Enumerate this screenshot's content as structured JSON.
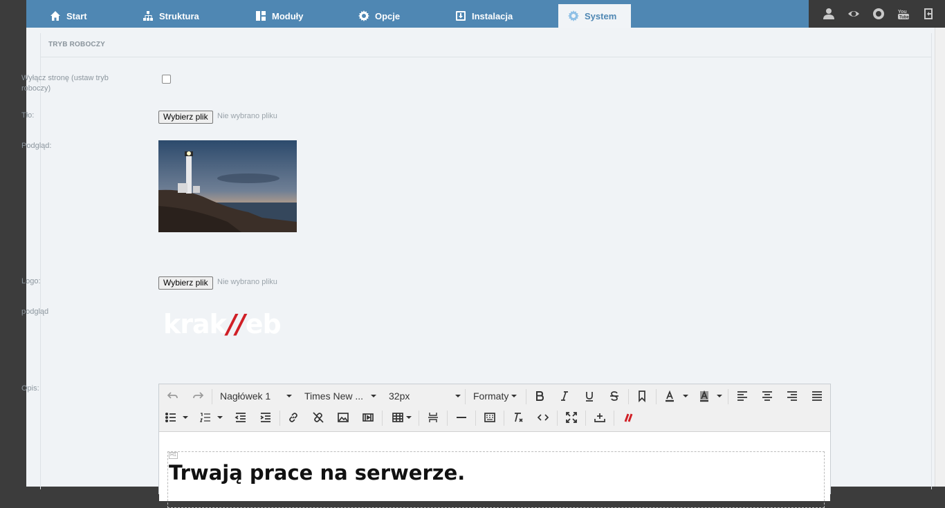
{
  "nav": {
    "tabs": [
      {
        "label": "Start",
        "icon": "home-icon"
      },
      {
        "label": "Struktura",
        "icon": "sitemap-icon"
      },
      {
        "label": "Moduły",
        "icon": "modules-icon"
      },
      {
        "label": "Opcje",
        "icon": "gear-icon"
      },
      {
        "label": "Instalacja",
        "icon": "install-icon"
      },
      {
        "label": "System",
        "icon": "system-gear-icon",
        "active": true
      }
    ],
    "right_icons": [
      "user-icon",
      "eye-icon",
      "lifebuoy-icon",
      "youtube-icon",
      "logout-icon"
    ]
  },
  "panel": {
    "title": "TRYB ROBOCZY",
    "maintenance_label": "Wyłącz stronę (ustaw tryb roboczy)",
    "maintenance_checked": false,
    "bg_label": "Tło:",
    "bg_button": "Wybierz plik",
    "bg_status": "Nie wybrano pliku",
    "preview_label": "Podgląd:",
    "logo_label": "Logo:",
    "logo_button": "Wybierz plik",
    "logo_status": "Nie wybrano pliku",
    "logo_preview_label": "podgląd",
    "logo_text_left": "krak",
    "logo_text_slash": "//",
    "logo_text_right": "eb",
    "desc_label": "Opis:"
  },
  "editor": {
    "format": "Nagłówek 1",
    "font": "Times New ...",
    "size": "32px",
    "formats_menu": "Formaty",
    "content_tag": "H1",
    "content_heading": "Trwają prace na serwerze."
  },
  "colors": {
    "topbar": "#4f87b3",
    "accent_red": "#d01f26"
  }
}
